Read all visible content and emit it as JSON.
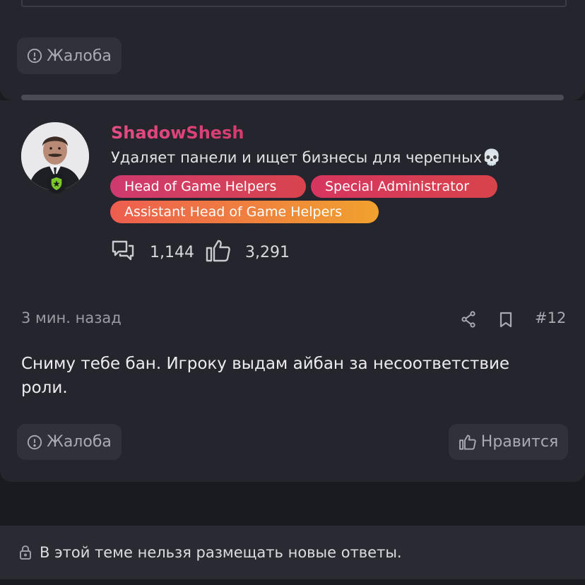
{
  "previous_post": {
    "report_label": "Жалоба"
  },
  "post": {
    "author": {
      "username": "ShadowShesh",
      "custom_title": "Удаляет панели и ищет бизнесы для черепных",
      "title_emoji": "💀",
      "badges": [
        "Head of Game Helpers",
        "Special Administrator",
        "Assistant Head of Game Helpers"
      ],
      "stats": {
        "messages": "1,144",
        "reactions": "3,291"
      }
    },
    "time_ago": "3 мин. назад",
    "post_number": "#12",
    "body": "Сниму тебе бан. Игроку выдам айбан за несоответствие роли.",
    "report_label": "Жалоба",
    "like_label": "Нравится"
  },
  "thread_locked_notice": "В этой теме нельзя размещать новые ответы.",
  "colors": {
    "background": "#1a1b20",
    "card": "#25262d",
    "username": "#e44d84",
    "badge_red": "#d6365f",
    "badge_orange": "#f0a22e",
    "avatar_badge": "#7cc62e"
  },
  "icons": {
    "report": "alert-circle-icon",
    "messages": "speech-bubbles-icon",
    "reactions": "thumbs-up-icon",
    "share": "share-icon",
    "bookmark": "bookmark-icon",
    "lock": "lock-icon"
  }
}
